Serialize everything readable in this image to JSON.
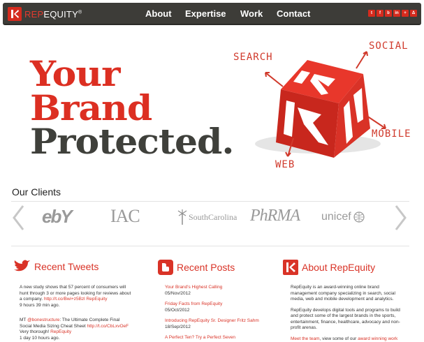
{
  "brand": {
    "logo_rep": "REP",
    "logo_equity": "EQUITY",
    "logo_tm": "®"
  },
  "nav": {
    "items": [
      {
        "label": "About"
      },
      {
        "label": "Expertise"
      },
      {
        "label": "Work"
      },
      {
        "label": "Contact"
      }
    ],
    "social": [
      "t",
      "f",
      "b",
      "in",
      "+",
      "Δ"
    ]
  },
  "hero": {
    "line1": "Your",
    "line2": "Brand",
    "line3": "Protected.",
    "scrawl": {
      "search": "SEARCH",
      "social": "SOCIAL",
      "mobile": "MOBILE",
      "web": "WEB"
    }
  },
  "clients": {
    "title": "Our Clients",
    "logos": [
      "ebY",
      "IAC",
      "SouthCarolina",
      "PhRMA",
      "unicef"
    ]
  },
  "tweets": {
    "title": "Recent Tweets",
    "items": [
      {
        "text": "A new study shows that 57 percent of consumers will hunt through 3 or more pages looking for reviews about a company.",
        "link": "http://t.co/Bwi+z5Bzl RepEquity",
        "time": "9 hours 39 min ago."
      },
      {
        "prefix": "MT ",
        "mention": "@bonestructure",
        "text": ": The Ultimate Complete Final Social Media Sizing Cheat Sheet ",
        "link": "http://t.co/CbLxvOeF",
        "tail": "Very thorough! ",
        "tail_link": "RepEquity",
        "time": "1 day 10 hours ago."
      }
    ]
  },
  "posts": {
    "title": "Recent Posts",
    "items": [
      {
        "title": "Your Brand's Highest Calling",
        "date": "05/Nov/2012"
      },
      {
        "title": "Friday Facts from RepEquity",
        "date": "05/Oct/2012"
      },
      {
        "title": "Introducing RepEquity Sr. Designer Fritz Sahm",
        "date": "18/Sep/2012"
      },
      {
        "title": "A Perfect Ten? Try a Perfect Seven",
        "date": ""
      }
    ]
  },
  "about": {
    "title": "About RepEquity",
    "p1": "RepEquity is an award-winning online brand management company specializing in search, social media, web and mobile development and analytics.",
    "p2": "RepEquity develops digital tools and programs to build and protect some of the largest brands in the sports, entertainment, finance, healthcare, advocacy and non-profit arenas.",
    "p3_link1": "Meet the team",
    "p3_mid": ", view some of our ",
    "p3_link2": "award winning work"
  },
  "colors": {
    "accent": "#d93327",
    "nav_bg": "#3d3c38",
    "hero_dark": "#3f403b"
  }
}
